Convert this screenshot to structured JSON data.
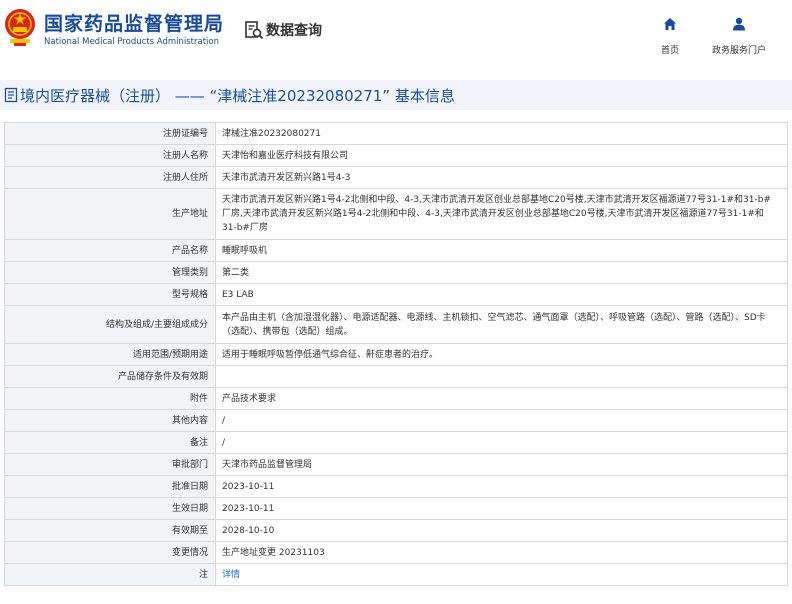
{
  "header": {
    "brand_cn": "国家药品监督管理局",
    "brand_en": "National Medical Products Administration",
    "query_label": "数据查询",
    "nav": [
      {
        "label": "首页",
        "icon": "home-icon"
      },
      {
        "label": "政务服务门户",
        "icon": "user-icon"
      }
    ]
  },
  "title": "境内医疗器械（注册） —— “津械注准20232080271” 基本信息",
  "colors": {
    "brand": "#1a4a9a",
    "title": "#1c4f9c",
    "link": "#1c6ad0",
    "label_bg": "#f2f3f7",
    "border": "#d8d8d8"
  },
  "rows": [
    {
      "label": "注册证编号",
      "value": "津械注准20232080271"
    },
    {
      "label": "注册人名称",
      "value": "天津怡和嘉业医疗科技有限公司"
    },
    {
      "label": "注册人住所",
      "value": "天津市武清开发区新兴路1号4-3"
    },
    {
      "label": "生产地址",
      "value": "天津市武清开发区新兴路1号4-2北侧和中段、4-3,天津市武清开发区创业总部基地C20号楼,天津市武清开发区福源道77号31-1#和31-b#厂房,天津市武清开发区新兴路1号4-2北侧和中段、4-3,天津市武清开发区创业总部基地C20号楼,天津市武清开发区福源道77号31-1#和31-b#厂房"
    },
    {
      "label": "产品名称",
      "value": "睡眠呼吸机"
    },
    {
      "label": "管理类别",
      "value": "第二类"
    },
    {
      "label": "型号规格",
      "value": "E3 LAB"
    },
    {
      "label": "结构及组成/主要组成成分",
      "value": "本产品由主机（含加湿湿化器）、电源适配器、电源线、主机锁扣、空气滤芯、通气面罩（选配）、呼吸管路（选配）、管路（选配）、SD卡（选配）、携带包（选配）组成。"
    },
    {
      "label": "适用范围/预期用途",
      "value": "适用于睡眠呼吸暂停低通气综合征、鼾症患者的治疗。"
    },
    {
      "label": "产品储存条件及有效期",
      "value": ""
    },
    {
      "label": "附件",
      "value": "产品技术要求"
    },
    {
      "label": "其他内容",
      "value": "/"
    },
    {
      "label": "备注",
      "value": "/"
    },
    {
      "label": "审批部门",
      "value": "天津市药品监督管理局"
    },
    {
      "label": "批准日期",
      "value": "2023-10-11"
    },
    {
      "label": "生效日期",
      "value": "2023-10-11"
    },
    {
      "label": "有效期至",
      "value": "2028-10-10"
    },
    {
      "label": "变更情况",
      "value": "生产地址变更 20231103"
    },
    {
      "label": "注",
      "value": "详情",
      "link": true
    }
  ]
}
